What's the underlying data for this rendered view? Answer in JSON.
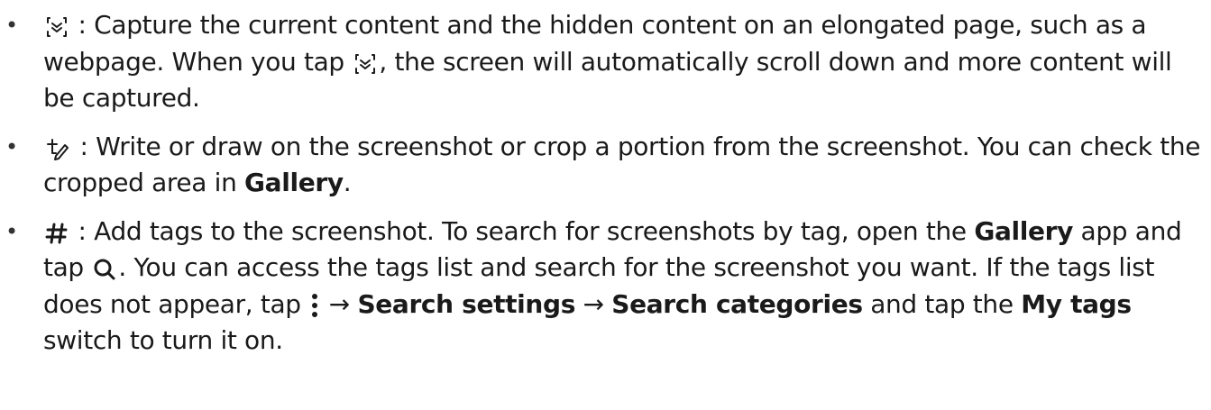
{
  "bullet_char": "•",
  "items": [
    {
      "icon": "scroll-capture-icon",
      "t1": " : Capture the current content and the hidden content on an elongated page, such as a webpage. When you tap ",
      "icon2": "scroll-capture-icon",
      "t2": ", the screen will automatically scroll down and more content will be captured."
    },
    {
      "icon": "draw-crop-icon",
      "t1": " : Write or draw on the screenshot or crop a portion from the screenshot. You can check the cropped area in ",
      "b1": "Gallery",
      "t2": "."
    },
    {
      "icon": "hashtag-icon",
      "t1": " : Add tags to the screenshot. To search for screenshots by tag, open the ",
      "b1": "Gallery",
      "t2": " app and tap ",
      "icon2": "search-icon",
      "t3": ". You can access the tags list and search for the screenshot you want. If the tags list does not appear, tap ",
      "icon3": "more-options-icon",
      "t4": " → ",
      "b2": "Search settings",
      "t5": " → ",
      "b3": "Search categories",
      "t6": " and tap the ",
      "b4": "My tags",
      "t7": " switch to turn it on."
    }
  ]
}
